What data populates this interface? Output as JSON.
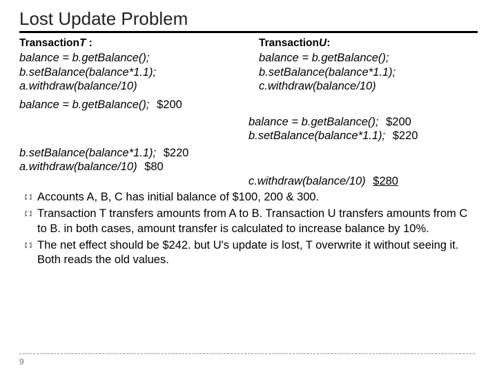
{
  "title": "Lost Update Problem",
  "transactions": {
    "t": {
      "heading_label": "Transaction",
      "heading_name": "T",
      "heading_colon": " :",
      "line1": "balance = b.getBalance();",
      "line2": "b.setBalance(balance*1.1);",
      "line3": "a.withdraw(balance/10)"
    },
    "u": {
      "heading_label": "Transaction",
      "heading_name": "U",
      "heading_colon": ":",
      "line1": "balance = b.getBalance();",
      "line2": "b.setBalance(balance*1.1);",
      "line3": "c.withdraw(balance/10)"
    }
  },
  "trace": {
    "r1": {
      "left_code": "balance =  b.getBalance();",
      "left_val": "$200"
    },
    "r2": {
      "right_code": "balance = b.getBalance();",
      "right_val": "$200"
    },
    "r3": {
      "right_code": "b.setBalance(balance*1.1);",
      "right_val": "$220"
    },
    "r4": {
      "left_code": "b.setBalance(balance*1.1);",
      "left_val": "$220"
    },
    "r5": {
      "left_code": "a.withdraw(balance/10)",
      "left_val": "$80"
    },
    "r6": {
      "right_code": "c.withdraw(balance/10)",
      "right_val": "$280"
    }
  },
  "bullets": {
    "b1": "Accounts A, B, C has initial balance of $100, 200 & 300.",
    "b2": "Transaction T transfers amounts from A to B. Transaction U transfers amounts from C to B. in both cases, amount transfer is calculated to increase balance by 10%.",
    "b3": "The net effect should be $242. but U's update is lost, T overwrite it without seeing it. Both reads the old values."
  },
  "page_number": "9"
}
